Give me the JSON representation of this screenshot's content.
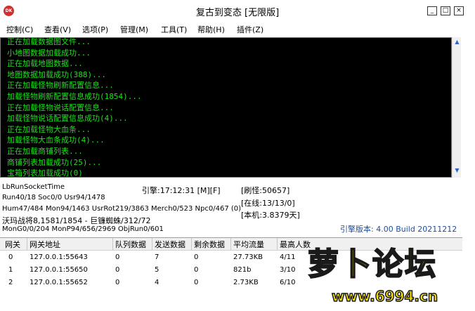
{
  "window": {
    "title": "复古到变态 [无限版]",
    "app_icon_text": "DK",
    "buttons": {
      "minimize": "_",
      "maximize": "□",
      "close": "×"
    }
  },
  "menubar": [
    "控制(C)",
    "查看(V)",
    "选项(P)",
    "管理(M)",
    "工具(T)",
    "帮助(H)",
    "插件(Z)"
  ],
  "console": {
    "lines": [
      "正在加载数据图文件...",
      "小地图数据加载成功...",
      "正在加载地图数据...",
      "地图数据加载成功(388)...",
      "正在加载怪物刷新配置信息...",
      "加载怪物刷新配置信息成功(1854)...",
      "正在加载怪物说话配置信息...",
      "加载怪物说话配置信息成功(4)...",
      "正在加载怪物大血条...",
      "加载怪物大血条成功(4)...",
      "正在加载商铺列表...",
      "商铺列表加载成功(25)...",
      "宝箱列表加载成功(0)"
    ],
    "text_color": "#1ee01e"
  },
  "status": {
    "socket_time": "LbRunSocketTime",
    "engine_time": "引擎:17:12:31 [M][F]",
    "refresh": "[刷怪:50657]",
    "run_line": "Run40/18 Soc0/0 Usr94/1478",
    "online": "[在线:13/13/0]",
    "hum_line": "Hum47/484 Mon94/1463 UsrRot219/3863 Merch0/523 Npc0/467 (0)",
    "uptime": "[本机:3.8379天]",
    "war_line": "沃玛战将8,1581/1854 - 巨镰蜘蛛/312/72",
    "mon_line": "MonG0/0/204 MonP94/656/2969 ObjRun0/601",
    "engine_version": "引擎版本: 4.00 Build 20211212",
    "version_color": "#1f4e9a"
  },
  "gateway_table": {
    "headers": [
      "网关",
      "网关地址",
      "队列数据",
      "发送数据",
      "剩余数据",
      "平均流量",
      "最高人数"
    ],
    "rows": [
      [
        "0",
        "127.0.0.1:55643",
        "0",
        "7",
        "0",
        "27.73KB",
        "4/11"
      ],
      [
        "1",
        "127.0.0.1:55650",
        "0",
        "5",
        "0",
        "821b",
        "3/10"
      ],
      [
        "2",
        "127.0.0.1:55652",
        "0",
        "4",
        "0",
        "2.73KB",
        "6/10"
      ]
    ]
  },
  "watermark": {
    "title": "萝卜论坛",
    "url": "www.6994.cn",
    "color": "#ffe600"
  }
}
